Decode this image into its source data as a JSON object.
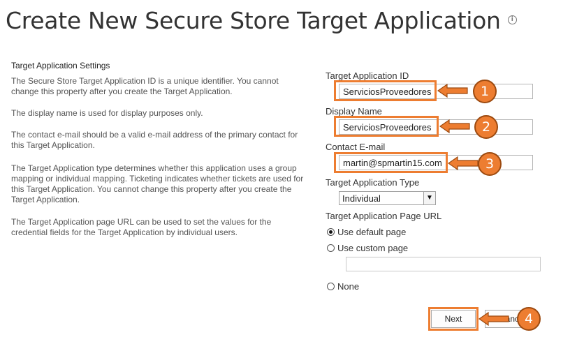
{
  "page": {
    "title": "Create New Secure Store Target Application",
    "info_icon": "i"
  },
  "description": {
    "heading": "Target Application Settings",
    "paragraphs": [
      "The Secure Store Target Application ID is a unique identifier. You cannot change this property after you create the Target Application.",
      "The display name is used for display purposes only.",
      "The contact e-mail should be a valid e-mail address of the primary contact for this Target Application.",
      "The Target Application type determines whether this application uses a group mapping or individual mapping. Ticketing indicates whether tickets are used for this Target Application. You cannot change this property after you create the Target Application.",
      "The Target Application page URL can be used to set the values for the credential fields for the Target Application by individual users."
    ]
  },
  "form": {
    "app_id_label": "Target Application ID",
    "app_id_value": "ServiciosProveedores",
    "display_name_label": "Display Name",
    "display_name_value": "ServiciosProveedores",
    "contact_email_label": "Contact E-mail",
    "contact_email_value": "martin@spmartin15.com",
    "type_label": "Target Application Type",
    "type_selected": "Individual",
    "page_url_label": "Target Application Page URL",
    "radio_default": "Use default page",
    "radio_custom": "Use custom page",
    "custom_url_value": "",
    "radio_none": "None",
    "selected_radio": "default"
  },
  "buttons": {
    "next": "Next",
    "cancel": "Cancel"
  },
  "callouts": [
    "1",
    "2",
    "3",
    "4"
  ],
  "colors": {
    "highlight": "#ed7d31",
    "callout_border": "#9c4a10"
  }
}
